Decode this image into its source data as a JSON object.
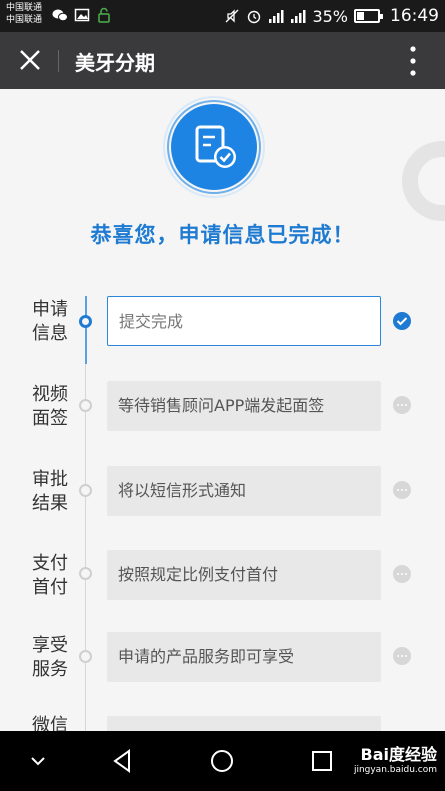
{
  "status_bar": {
    "carrier_1": "中国联通",
    "carrier_2": "中国联通",
    "battery_percent": "35%",
    "battery_level": 0.35,
    "time": "16:49"
  },
  "title_bar": {
    "title": "美牙分期"
  },
  "hero": {
    "message": "恭喜您，申请信息已完成！"
  },
  "steps": [
    {
      "label": "申请信息",
      "text": "提交完成",
      "status": "done"
    },
    {
      "label": "视频面签",
      "text": "等待销售顾问APP端发起面签",
      "status": "pending"
    },
    {
      "label": "审批结果",
      "text": "将以短信形式通知",
      "status": "pending"
    },
    {
      "label": "支付首付",
      "text": "按照规定比例支付首付",
      "status": "pending"
    },
    {
      "label": "享受服务",
      "text": "申请的产品服务即可享受",
      "status": "pending"
    },
    {
      "label": "微信",
      "text": "",
      "status": "pending"
    }
  ],
  "watermark": {
    "brand": "Bai度经验",
    "url": "jingyan.baidu.com"
  },
  "colors": {
    "accent": "#1e7bd1",
    "title_bar": "#3a3a3d"
  }
}
